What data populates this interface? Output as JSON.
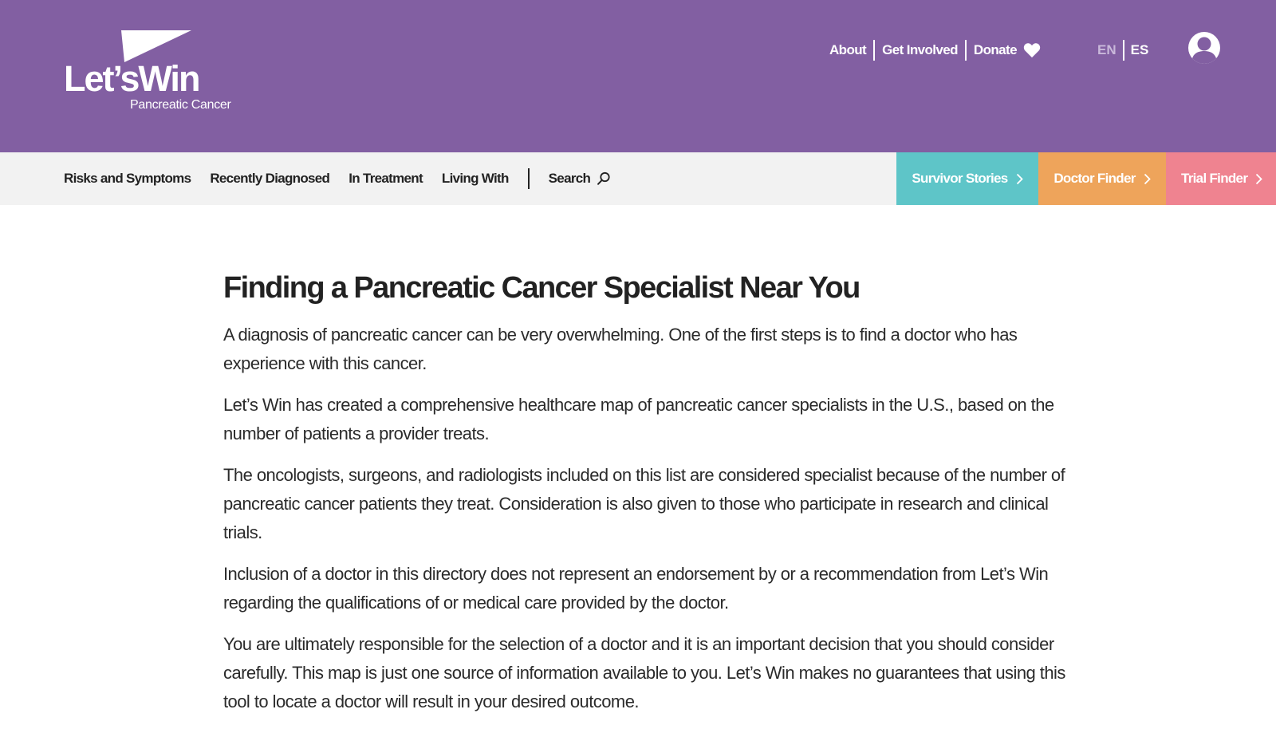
{
  "brand": {
    "name": "Let’sWin",
    "tagline": "Pancreatic Cancer",
    "color": "#825fa2"
  },
  "utility_nav": {
    "items": [
      "About",
      "Get Involved",
      "Donate"
    ],
    "donate_icon": "heart-icon"
  },
  "language": {
    "options": [
      "EN",
      "ES"
    ],
    "selected": "ES"
  },
  "account": {
    "icon": "user-avatar-icon"
  },
  "main_nav": {
    "items": [
      "Risks and Symptoms",
      "Recently Diagnosed",
      "In Treatment",
      "Living With"
    ],
    "search_label": "Search",
    "search_icon": "search-icon"
  },
  "cta_tabs": [
    {
      "label": "Survivor Stories",
      "color": "#5ec5c8"
    },
    {
      "label": "Doctor Finder",
      "color": "#eea45b"
    },
    {
      "label": "Trial Finder",
      "color": "#ef8390"
    }
  ],
  "article": {
    "title": "Finding a Pancreatic Cancer Specialist Near You",
    "paragraphs": [
      "A diagnosis of pancreatic cancer can be very overwhelming. One of the first steps is to find a doctor who has experience with this cancer.",
      "Let’s Win has created a comprehensive healthcare map of pancreatic cancer specialists in the U.S., based on the number of patients a provider treats.",
      "The oncologists, surgeons, and radiologists included on this list are considered specialist because of the number of pancreatic cancer patients they treat. Consideration is also given to those who participate in research and clinical trials.",
      "Inclusion of a doctor in this directory does not represent an endorsement by or a recommendation from Let’s Win regarding the qualifications of or medical care provided by the doctor.",
      "You are ultimately responsible for the selection of a doctor and it is an important decision that you should consider carefully. This map is just one source of information available to you. Let’s Win makes no guarantees that using this tool to locate a doctor will result in your desired outcome."
    ]
  }
}
